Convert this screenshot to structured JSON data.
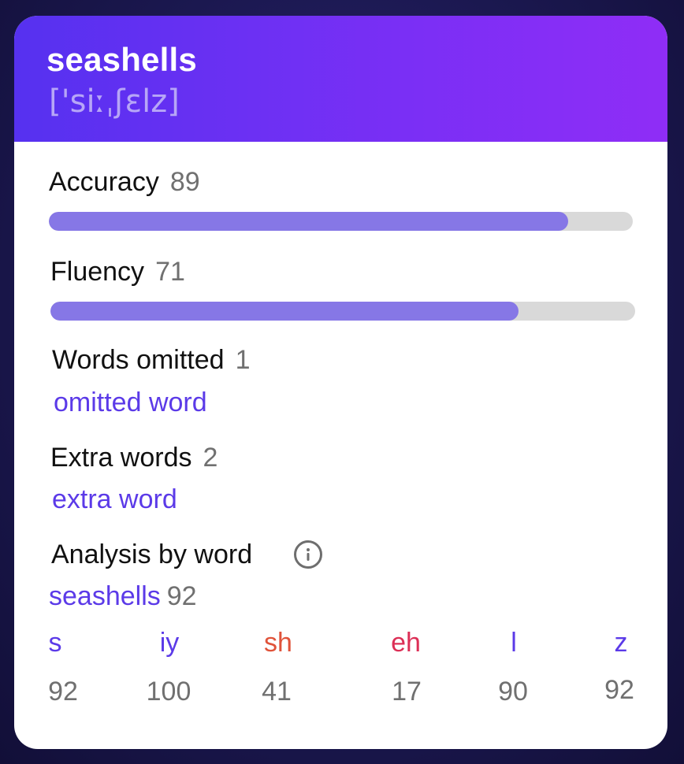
{
  "header": {
    "word": "seashells",
    "phonetic": "['siːˌʃɛlz]"
  },
  "accuracy": {
    "label": "Accuracy",
    "score": "89",
    "fraction": 0.89
  },
  "fluency": {
    "label": "Fluency",
    "score": "71",
    "fraction": 0.8
  },
  "words_omitted": {
    "label": "Words omitted",
    "count": "1",
    "link": "omitted word"
  },
  "extra_words": {
    "label": "Extra words",
    "count": "2",
    "link": "extra word"
  },
  "analysis": {
    "label": "Analysis by word",
    "info_icon": "info-icon",
    "word": "seashells",
    "word_score": "92",
    "phonemes": [
      {
        "symbol": "s",
        "score": "92",
        "color": "#5b3ae8"
      },
      {
        "symbol": "iy",
        "score": "100",
        "color": "#5b3ae8"
      },
      {
        "symbol": "sh",
        "score": "41",
        "color": "#e0533a"
      },
      {
        "symbol": "eh",
        "score": "17",
        "color": "#dc2f56"
      },
      {
        "symbol": "l",
        "score": "90",
        "color": "#5b3ae8"
      },
      {
        "symbol": "z",
        "score": "92",
        "color": "#5b3ae8"
      }
    ]
  },
  "colors": {
    "accent": "#5b3ae8",
    "bar_fill": "#8677e6",
    "bar_track": "#d9d9d9",
    "header_start": "#5631f0",
    "header_end": "#8f2df6"
  }
}
